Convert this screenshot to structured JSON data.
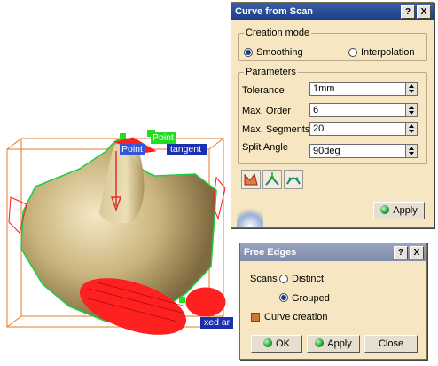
{
  "viewport": {
    "tags": {
      "point_top": "Point",
      "point_tangent_left": "Point",
      "point_tangent_right": "tangent",
      "fixed": "xed ar"
    }
  },
  "curve_dialog": {
    "title": "Curve from Scan",
    "help_label": "?",
    "close_label": "X",
    "creation_mode": {
      "legend": "Creation mode",
      "smoothing": "Smoothing",
      "interpolation": "Interpolation",
      "selected": "Smoothing"
    },
    "parameters": {
      "legend": "Parameters",
      "tolerance_label": "Tolerance",
      "tolerance_value": "1mm",
      "max_order_label": "Max. Order",
      "max_order_value": "6",
      "max_segments_label": "Max. Segments",
      "max_segments_value": "20",
      "split_angle_label": "Split Angle",
      "split_angle_value": "90deg"
    },
    "toolbar_icons": [
      "split-curve-icon",
      "vertex-icon",
      "curve-arc-icon"
    ],
    "apply_label": "Apply"
  },
  "free_edges_dialog": {
    "title": "Free Edges",
    "help_label": "?",
    "close_label": "X",
    "scans_label": "Scans",
    "distinct": "Distinct",
    "grouped": "Grouped",
    "selected": "Grouped",
    "curve_creation": "Curve creation",
    "ok_label": "OK",
    "apply_label": "Apply",
    "close_button_label": "Close"
  }
}
